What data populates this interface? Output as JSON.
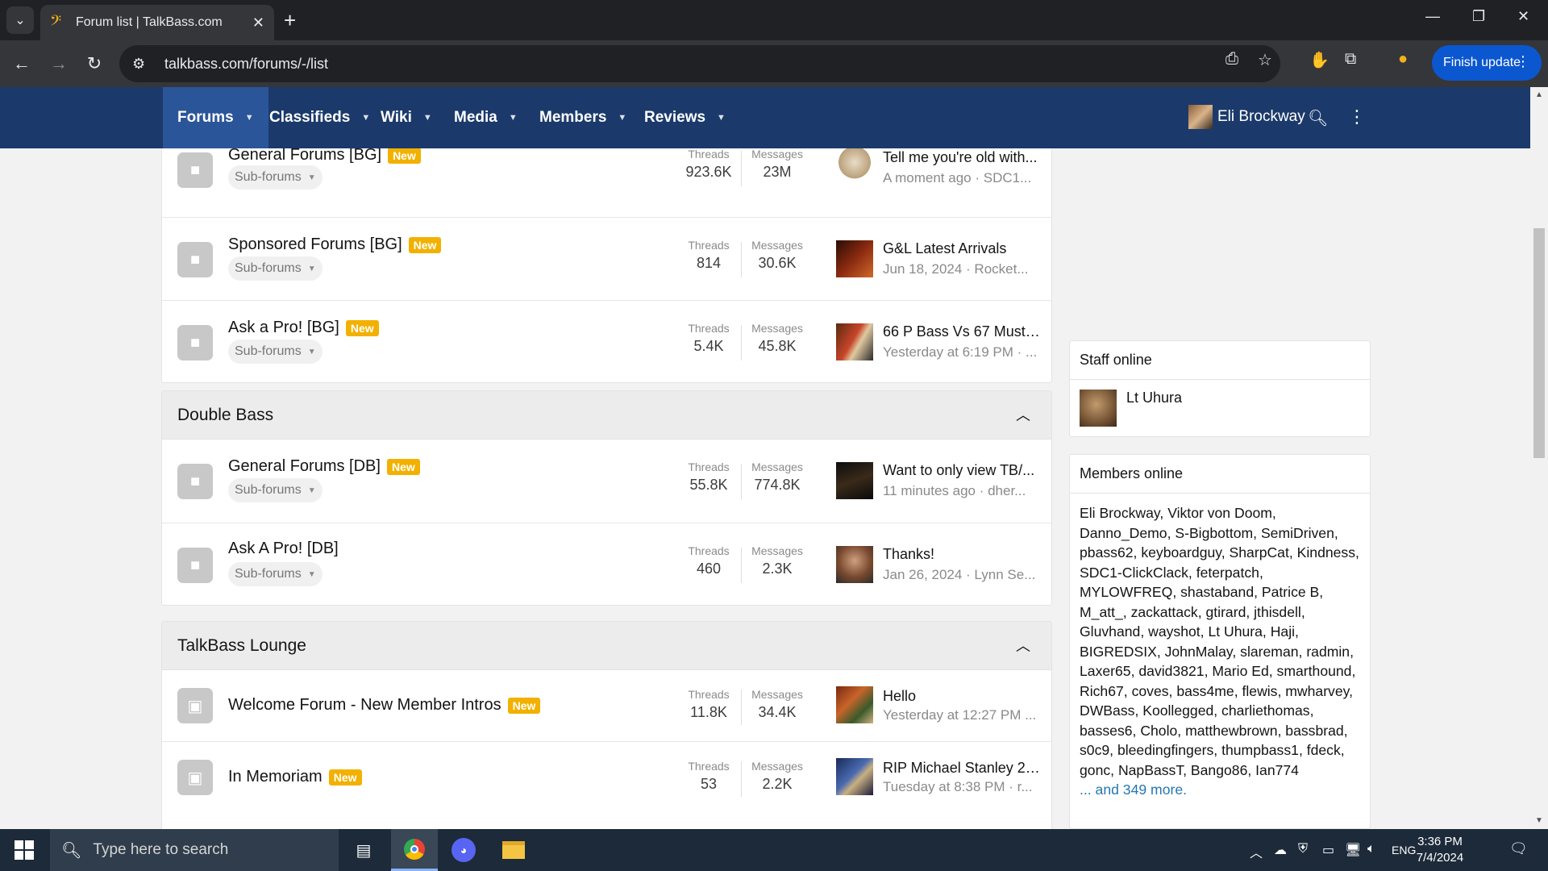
{
  "browser": {
    "tab_title": "Forum list | TalkBass.com",
    "url": "talkbass.com/forums/-/list",
    "finish_update_label": "Finish update"
  },
  "nav": {
    "items": [
      {
        "label": "Forums",
        "active": true
      },
      {
        "label": "Classifieds"
      },
      {
        "label": "Wiki"
      },
      {
        "label": "Media"
      },
      {
        "label": "Members"
      },
      {
        "label": "Reviews"
      }
    ],
    "user_name": "Eli Brockway"
  },
  "sections": {
    "bass_guitar": {
      "nodes": [
        {
          "title": "General Forums [BG]",
          "new_badge": "New",
          "subforums": "Sub-forums",
          "threads_label": "Threads",
          "threads": "923.6K",
          "messages_label": "Messages",
          "messages": "23M",
          "last_title": "Tell me you're old with...",
          "last_meta": "A moment ago · SDC1..."
        },
        {
          "title": "Sponsored Forums [BG]",
          "new_badge": "New",
          "subforums": "Sub-forums",
          "threads_label": "Threads",
          "threads": "814",
          "messages_label": "Messages",
          "messages": "30.6K",
          "last_title": "G&L Latest Arrivals",
          "last_meta": "Jun 18, 2024 · Rocket..."
        },
        {
          "title": "Ask a Pro! [BG]",
          "new_badge": "New",
          "subforums": "Sub-forums",
          "threads_label": "Threads",
          "threads": "5.4K",
          "messages_label": "Messages",
          "messages": "45.8K",
          "last_title": "66 P Bass Vs 67 Musta...",
          "last_meta": "Yesterday at 6:19 PM · ..."
        }
      ]
    },
    "double_bass": {
      "title": "Double Bass",
      "nodes": [
        {
          "title": "General Forums [DB]",
          "new_badge": "New",
          "subforums": "Sub-forums",
          "threads_label": "Threads",
          "threads": "55.8K",
          "messages_label": "Messages",
          "messages": "774.8K",
          "last_title": "Want to only view TB/...",
          "last_meta": "11 minutes ago · dher..."
        },
        {
          "title": "Ask A Pro! [DB]",
          "subforums": "Sub-forums",
          "threads_label": "Threads",
          "threads": "460",
          "messages_label": "Messages",
          "messages": "2.3K",
          "last_title": "Thanks!",
          "last_meta": "Jan 26, 2024 · Lynn Se..."
        }
      ]
    },
    "lounge": {
      "title": "TalkBass Lounge",
      "nodes": [
        {
          "title": "Welcome Forum - New Member Intros",
          "new_badge": "New",
          "threads_label": "Threads",
          "threads": "11.8K",
          "messages_label": "Messages",
          "messages": "34.4K",
          "last_title": "Hello",
          "last_meta": "Yesterday at 12:27 PM ..."
        },
        {
          "title": "In Memoriam",
          "new_badge": "New",
          "threads_label": "Threads",
          "threads": "53",
          "messages_label": "Messages",
          "messages": "2.2K",
          "last_title": "RIP Michael Stanley 21...",
          "last_meta": "Tuesday at 8:38 PM · r..."
        }
      ]
    }
  },
  "sidebar": {
    "staff_title": "Staff online",
    "staff": [
      "Lt Uhura"
    ],
    "members_title": "Members online",
    "members": [
      "Eli Brockway",
      "Viktor von Doom",
      "Danno_Demo",
      "S-Bigbottom",
      "SemiDriven",
      "pbass62",
      "keyboardguy",
      "SharpCat",
      "Kindness",
      "SDC1-ClickClack",
      "feterpatch",
      "MYLOWFREQ",
      "shastaband",
      "Patrice B",
      "M_att_",
      "zackattack",
      "gtirard",
      "jthisdell",
      "Gluvhand",
      "wayshot",
      "Lt Uhura",
      "Haji",
      "BIGREDSIX",
      "JohnMalay",
      "slareman",
      "radmin",
      "Laxer65",
      "david3821",
      "Mario Ed",
      "smarthound",
      "Rich67",
      "coves",
      "bass4me",
      "flewis",
      "mwharvey",
      "DWBass",
      "Koollegged",
      "charliethomas",
      "basses6",
      "Cholo",
      "matthewbrown",
      "bassbrad",
      "s0c9",
      "bleedingfingers",
      "thumpbass1",
      "fdeck",
      "gonc",
      "NapBassT",
      "Bango86",
      "Ian774"
    ],
    "more_label": "... and 349 more."
  },
  "taskbar": {
    "search_placeholder": "Type here to search",
    "lang": "ENG",
    "time": "3:36 PM",
    "date": "7/4/2024"
  },
  "colors": {
    "nav_bg": "#1b3a6b",
    "nav_active": "#2b5599",
    "badge_new": "#f2b100",
    "link": "#2577b1"
  }
}
